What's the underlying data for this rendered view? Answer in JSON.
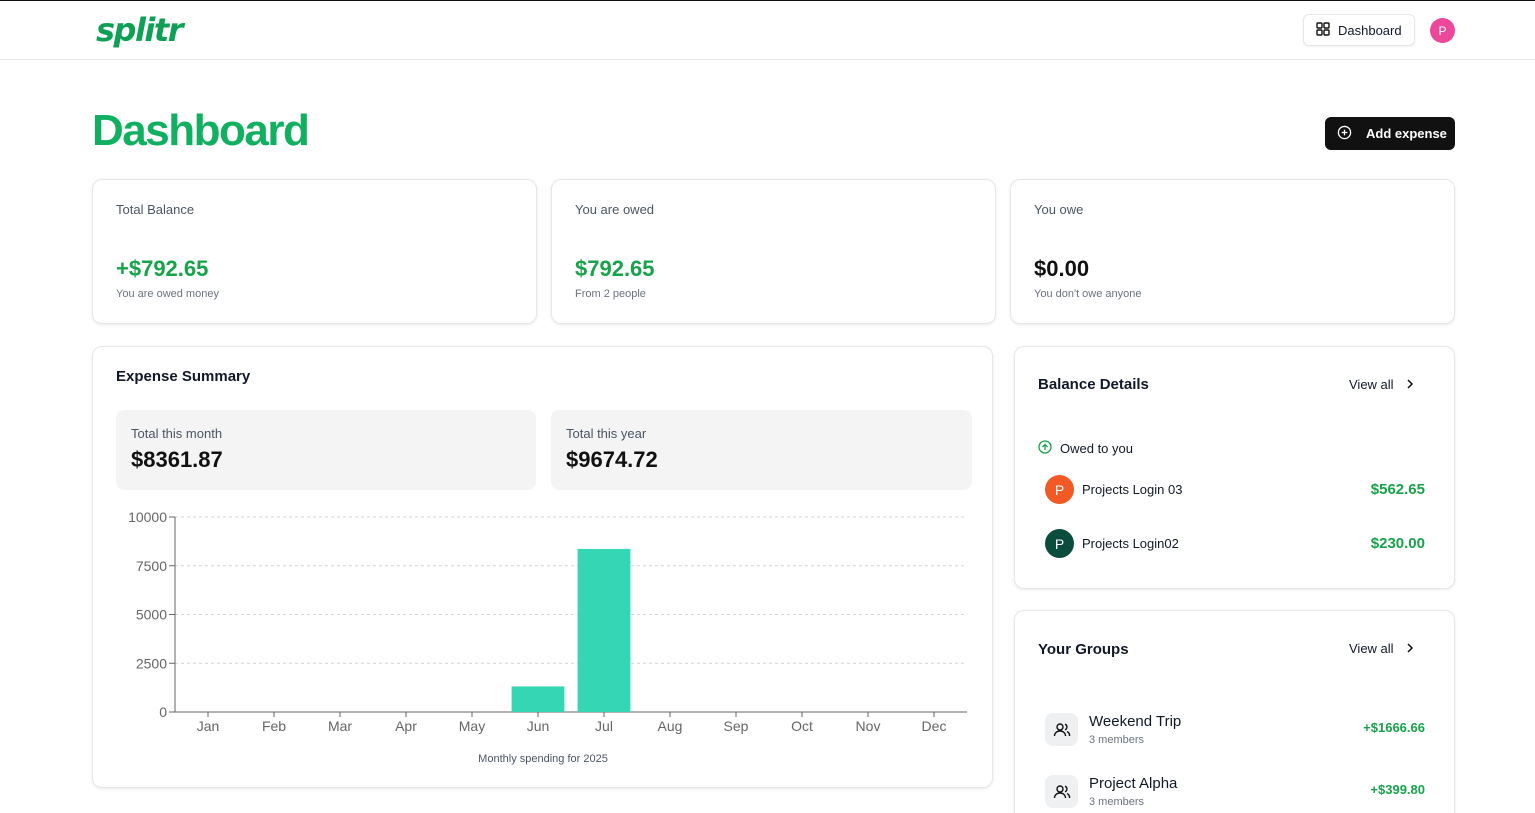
{
  "app": {
    "logo": "splitr"
  },
  "nav": {
    "dashboard_label": "Dashboard",
    "avatar_initial": "P"
  },
  "header": {
    "title": "Dashboard",
    "add_expense_label": "Add expense"
  },
  "stats": {
    "total_balance": {
      "label": "Total Balance",
      "value": "+$792.65",
      "sub": "You are owed money"
    },
    "owed": {
      "label": "You are owed",
      "value": "$792.65",
      "sub": "From 2 people"
    },
    "owe": {
      "label": "You owe",
      "value": "$0.00",
      "sub": "You don't owe anyone"
    }
  },
  "expense_summary": {
    "title": "Expense Summary",
    "month": {
      "label": "Total this month",
      "value": "$8361.87"
    },
    "year": {
      "label": "Total this year",
      "value": "$9674.72"
    },
    "caption": "Monthly spending for 2025"
  },
  "chart_data": {
    "type": "bar",
    "categories": [
      "Jan",
      "Feb",
      "Mar",
      "Apr",
      "May",
      "Jun",
      "Jul",
      "Aug",
      "Sep",
      "Oct",
      "Nov",
      "Dec"
    ],
    "values": [
      0,
      0,
      0,
      0,
      0,
      1312.85,
      8361.87,
      0,
      0,
      0,
      0,
      0
    ],
    "yticks": [
      0,
      2500,
      5000,
      7500,
      10000
    ],
    "ylim": [
      0,
      10000
    ],
    "xlabel": "",
    "ylabel": "",
    "grid": true,
    "bar_color": "#34d6b4"
  },
  "balance_details": {
    "title": "Balance Details",
    "view_all": "View all",
    "owed_heading": "Owed to you",
    "items": [
      {
        "initial": "P",
        "name": "Projects Login 03",
        "amount": "$562.65",
        "color": "#f15a24"
      },
      {
        "initial": "P",
        "name": "Projects Login02",
        "amount": "$230.00",
        "color": "#0b4d3c"
      }
    ]
  },
  "groups": {
    "title": "Your Groups",
    "view_all": "View all",
    "items": [
      {
        "name": "Weekend Trip",
        "members": "3 members",
        "amount": "+$1666.66"
      },
      {
        "name": "Project Alpha",
        "members": "3 members",
        "amount": "+$399.80"
      }
    ]
  },
  "colors": {
    "brand": "#10b060",
    "positive": "#16a34a",
    "bar": "#34d6b4",
    "button_dark": "#111111"
  }
}
